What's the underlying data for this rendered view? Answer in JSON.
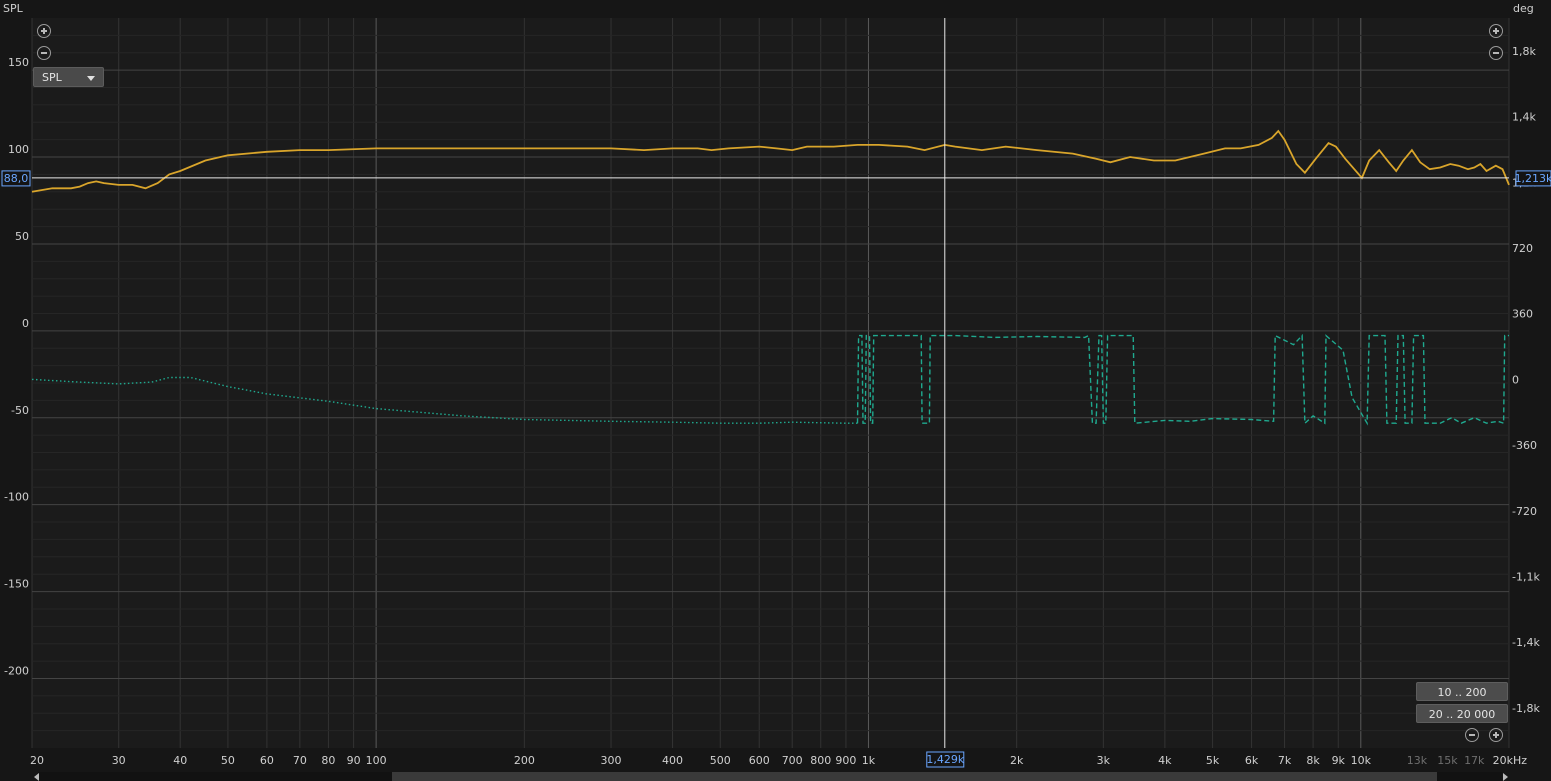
{
  "left_axis_title": "SPL",
  "right_axis_title": "deg",
  "measurement_select": "SPL",
  "range_buttons": {
    "y_range": "10 .. 200",
    "x_range": "20 .. 20 000"
  },
  "cursor": {
    "freq_label": "1,429k",
    "spl_label": "88,0",
    "phase_label": "1,213k"
  },
  "colors": {
    "background": "#1b1b1b",
    "grid": "#3a3a3a",
    "spl": "#d9a52b",
    "phase": "#1fa98f",
    "cursor": "#e8e8e8",
    "cursor_label": "#6aa6ff"
  },
  "icons": [
    "zoom-in-icon",
    "zoom-out-icon"
  ],
  "chart_data": {
    "type": "line",
    "x_scale": "log",
    "xlim": [
      20,
      20000
    ],
    "ylim_left": [
      -240,
      180
    ],
    "ylim_right": [
      -2020,
      1980
    ],
    "x_tick_labels": [
      {
        "v": 20,
        "t": "20"
      },
      {
        "v": 30,
        "t": "30"
      },
      {
        "v": 40,
        "t": "40"
      },
      {
        "v": 50,
        "t": "50"
      },
      {
        "v": 60,
        "t": "60"
      },
      {
        "v": 70,
        "t": "70"
      },
      {
        "v": 80,
        "t": "80"
      },
      {
        "v": 90,
        "t": "90"
      },
      {
        "v": 100,
        "t": "100"
      },
      {
        "v": 200,
        "t": "200"
      },
      {
        "v": 300,
        "t": "300"
      },
      {
        "v": 400,
        "t": "400"
      },
      {
        "v": 500,
        "t": "500"
      },
      {
        "v": 600,
        "t": "600"
      },
      {
        "v": 700,
        "t": "700"
      },
      {
        "v": 800,
        "t": "800"
      },
      {
        "v": 900,
        "t": "900"
      },
      {
        "v": 1000,
        "t": "1k"
      },
      {
        "v": 2000,
        "t": "2k"
      },
      {
        "v": 3000,
        "t": "3k"
      },
      {
        "v": 4000,
        "t": "4k"
      },
      {
        "v": 5000,
        "t": "5k"
      },
      {
        "v": 6000,
        "t": "6k"
      },
      {
        "v": 7000,
        "t": "7k"
      },
      {
        "v": 8000,
        "t": "8k"
      },
      {
        "v": 9000,
        "t": "9k"
      },
      {
        "v": 10000,
        "t": "10k"
      },
      {
        "v": 13000,
        "t": "13k"
      },
      {
        "v": 15000,
        "t": "15k"
      },
      {
        "v": 17000,
        "t": "17k"
      },
      {
        "v": 20000,
        "t": "20kHz"
      }
    ],
    "dim_x_tick_labels": [
      "13k",
      "15k",
      "17k"
    ],
    "left_ticks": [
      {
        "v": 150,
        "t": "150"
      },
      {
        "v": 100,
        "t": "100"
      },
      {
        "v": 50,
        "t": "50"
      },
      {
        "v": 0,
        "t": "0"
      },
      {
        "v": -50,
        "t": "-50"
      },
      {
        "v": -100,
        "t": "-100"
      },
      {
        "v": -150,
        "t": "-150"
      },
      {
        "v": -200,
        "t": "-200"
      }
    ],
    "right_ticks": [
      {
        "v": 1800,
        "t": "1,8k"
      },
      {
        "v": 1440,
        "t": "1,4k"
      },
      {
        "v": 1080,
        "t": "1,1k"
      },
      {
        "v": 720,
        "t": "720"
      },
      {
        "v": 360,
        "t": "360"
      },
      {
        "v": 0,
        "t": "0"
      },
      {
        "v": -360,
        "t": "-360"
      },
      {
        "v": -720,
        "t": "-720"
      },
      {
        "v": -1080,
        "t": "-1,1k"
      },
      {
        "v": -1440,
        "t": "-1,4k"
      },
      {
        "v": -1800,
        "t": "-1,8k"
      }
    ],
    "cursor": {
      "x": 1429,
      "y_spl": 88.0,
      "y_phase": 1213
    },
    "series": [
      {
        "axis": "left",
        "style": "solid",
        "points": [
          [
            20,
            80
          ],
          [
            22,
            82
          ],
          [
            24,
            82
          ],
          [
            25,
            83
          ],
          [
            26,
            85
          ],
          [
            27,
            86
          ],
          [
            28,
            85
          ],
          [
            30,
            84
          ],
          [
            32,
            84
          ],
          [
            34,
            82
          ],
          [
            36,
            85
          ],
          [
            38,
            90
          ],
          [
            40,
            92
          ],
          [
            45,
            98
          ],
          [
            50,
            101
          ],
          [
            60,
            103
          ],
          [
            70,
            104
          ],
          [
            80,
            104
          ],
          [
            100,
            105
          ],
          [
            150,
            105
          ],
          [
            200,
            105
          ],
          [
            300,
            105
          ],
          [
            350,
            104
          ],
          [
            400,
            105
          ],
          [
            450,
            105
          ],
          [
            480,
            104
          ],
          [
            520,
            105
          ],
          [
            600,
            106
          ],
          [
            650,
            105
          ],
          [
            700,
            104
          ],
          [
            750,
            106
          ],
          [
            850,
            106
          ],
          [
            950,
            107
          ],
          [
            1050,
            107
          ],
          [
            1200,
            106
          ],
          [
            1300,
            104
          ],
          [
            1429,
            107
          ],
          [
            1500,
            106
          ],
          [
            1700,
            104
          ],
          [
            1900,
            106
          ],
          [
            2200,
            104
          ],
          [
            2600,
            102
          ],
          [
            2900,
            99
          ],
          [
            3100,
            97
          ],
          [
            3400,
            100
          ],
          [
            3800,
            98
          ],
          [
            4200,
            98
          ],
          [
            4800,
            102
          ],
          [
            5300,
            105
          ],
          [
            5700,
            105
          ],
          [
            6200,
            107
          ],
          [
            6600,
            111
          ],
          [
            6800,
            115
          ],
          [
            7000,
            110
          ],
          [
            7400,
            96
          ],
          [
            7700,
            91
          ],
          [
            8100,
            99
          ],
          [
            8600,
            108
          ],
          [
            8900,
            106
          ],
          [
            9300,
            99
          ],
          [
            9700,
            93
          ],
          [
            10050,
            88
          ],
          [
            10400,
            98
          ],
          [
            10900,
            104
          ],
          [
            11400,
            97
          ],
          [
            11800,
            92
          ],
          [
            12200,
            98
          ],
          [
            12700,
            104
          ],
          [
            13200,
            97
          ],
          [
            13800,
            93
          ],
          [
            14500,
            94
          ],
          [
            15200,
            96
          ],
          [
            15800,
            95
          ],
          [
            16500,
            93
          ],
          [
            17000,
            94
          ],
          [
            17500,
            96
          ],
          [
            18000,
            92
          ],
          [
            18800,
            95
          ],
          [
            19400,
            93
          ],
          [
            20000,
            84
          ]
        ]
      },
      {
        "axis": "right",
        "style": "dotted",
        "points": [
          [
            20,
            0
          ],
          [
            25,
            -15
          ],
          [
            30,
            -25
          ],
          [
            35,
            -15
          ],
          [
            38,
            10
          ],
          [
            42,
            10
          ],
          [
            50,
            -40
          ],
          [
            60,
            -80
          ],
          [
            80,
            -120
          ],
          [
            100,
            -160
          ],
          [
            150,
            -200
          ],
          [
            200,
            -220
          ],
          [
            300,
            -230
          ],
          [
            400,
            -235
          ],
          [
            500,
            -240
          ],
          [
            600,
            -240
          ],
          [
            700,
            -235
          ],
          [
            900,
            -240
          ],
          [
            950,
            -240
          ]
        ]
      },
      {
        "axis": "right",
        "style": "dashed",
        "points": [
          [
            950,
            -240
          ],
          [
            955,
            240
          ],
          [
            970,
            240
          ],
          [
            975,
            -240
          ],
          [
            985,
            -240
          ],
          [
            990,
            240
          ],
          [
            1005,
            240
          ],
          [
            1010,
            -240
          ],
          [
            1020,
            -240
          ],
          [
            1025,
            240
          ],
          [
            1280,
            240
          ],
          [
            1285,
            -240
          ],
          [
            1330,
            -240
          ],
          [
            1335,
            240
          ],
          [
            1500,
            240
          ],
          [
            1800,
            230
          ],
          [
            2200,
            235
          ],
          [
            2750,
            230
          ],
          [
            2800,
            240
          ],
          [
            2850,
            -240
          ],
          [
            2900,
            -240
          ],
          [
            2940,
            240
          ],
          [
            2975,
            240
          ],
          [
            3000,
            -240
          ],
          [
            3035,
            -240
          ],
          [
            3060,
            240
          ],
          [
            3450,
            240
          ],
          [
            3475,
            -240
          ],
          [
            4000,
            -225
          ],
          [
            4500,
            -230
          ],
          [
            5000,
            -215
          ],
          [
            6000,
            -220
          ],
          [
            6650,
            -230
          ],
          [
            6700,
            240
          ],
          [
            7300,
            190
          ],
          [
            7600,
            240
          ],
          [
            7700,
            -240
          ],
          [
            8000,
            -200
          ],
          [
            8450,
            -240
          ],
          [
            8500,
            240
          ],
          [
            9200,
            160
          ],
          [
            9600,
            -100
          ],
          [
            10300,
            -240
          ],
          [
            10400,
            240
          ],
          [
            11200,
            240
          ],
          [
            11300,
            -240
          ],
          [
            11800,
            -240
          ],
          [
            11900,
            240
          ],
          [
            12200,
            240
          ],
          [
            12300,
            -240
          ],
          [
            12700,
            -240
          ],
          [
            12800,
            240
          ],
          [
            13400,
            240
          ],
          [
            13500,
            -240
          ],
          [
            14500,
            -240
          ],
          [
            15300,
            -210
          ],
          [
            16000,
            -240
          ],
          [
            17000,
            -210
          ],
          [
            18000,
            -240
          ],
          [
            19000,
            -230
          ],
          [
            19500,
            -240
          ],
          [
            19600,
            240
          ],
          [
            20000,
            240
          ]
        ]
      }
    ]
  }
}
